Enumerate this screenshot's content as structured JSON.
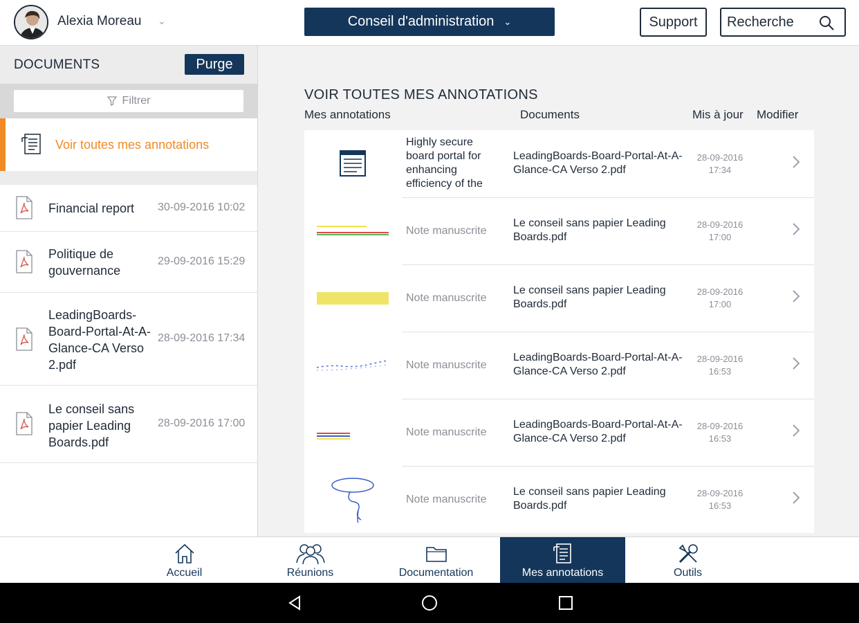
{
  "header": {
    "user_name": "Alexia Moreau",
    "board_label": "Conseil d'administration",
    "support_label": "Support",
    "search_label": "Recherche"
  },
  "sidebar": {
    "title": "DOCUMENTS",
    "purge_label": "Purge",
    "filter_placeholder": "Filtrer",
    "active_item_label": "Voir toutes mes annotations",
    "documents": [
      {
        "name": "Financial report",
        "date": "30-09-2016 10:02"
      },
      {
        "name": "Politique de gouvernance",
        "date": "29-09-2016 15:29"
      },
      {
        "name": "LeadingBoards-Board-Portal-At-A-Glance-CA Verso 2.pdf",
        "date": "28-09-2016 17:34"
      },
      {
        "name": "Le conseil sans papier Leading Boards.pdf",
        "date": "28-09-2016 17:00"
      }
    ]
  },
  "main": {
    "title": "VOIR TOUTES MES ANNOTATIONS",
    "columns": {
      "annotations": "Mes annotations",
      "documents": "Documents",
      "updated": "Mis à jour",
      "edit": "Modifier"
    },
    "rows": [
      {
        "note": "Highly secure board portal for enhancing efficiency of the",
        "document": "LeadingBoards-Board-Portal-At-A-Glance-CA Verso 2.pdf",
        "date": "28-09-2016",
        "time": "17:34",
        "thumb": "text-note-icon"
      },
      {
        "note": "Note manuscrite",
        "document": "Le conseil sans papier Leading Boards.pdf",
        "date": "28-09-2016",
        "time": "17:00",
        "thumb": "lines-yellow-red-green"
      },
      {
        "note": "Note manuscrite",
        "document": "Le conseil sans papier Leading Boards.pdf",
        "date": "28-09-2016",
        "time": "17:00",
        "thumb": "yellow-highlight"
      },
      {
        "note": "Note manuscrite",
        "document": "LeadingBoards-Board-Portal-At-A-Glance-CA Verso 2.pdf",
        "date": "28-09-2016",
        "time": "16:53",
        "thumb": "dotted-blue-line"
      },
      {
        "note": "Note manuscrite",
        "document": "LeadingBoards-Board-Portal-At-A-Glance-CA Verso 2.pdf",
        "date": "28-09-2016",
        "time": "16:53",
        "thumb": "lines-red-blue-yellow"
      },
      {
        "note": "Note manuscrite",
        "document": "Le conseil sans papier Leading Boards.pdf",
        "date": "28-09-2016",
        "time": "16:53",
        "thumb": "blue-loop-drawing"
      }
    ]
  },
  "bottom_nav": [
    {
      "label": "Accueil",
      "icon": "home-icon"
    },
    {
      "label": "Réunions",
      "icon": "people-icon"
    },
    {
      "label": "Documentation",
      "icon": "folder-icon"
    },
    {
      "label": "Mes annotations",
      "icon": "annotation-icon",
      "active": true
    },
    {
      "label": "Outils",
      "icon": "tools-icon"
    }
  ],
  "colors": {
    "navy": "#14365a",
    "accent_orange": "#f08a24",
    "muted_text": "#8a8f96",
    "pdf_red": "#d9534f"
  }
}
